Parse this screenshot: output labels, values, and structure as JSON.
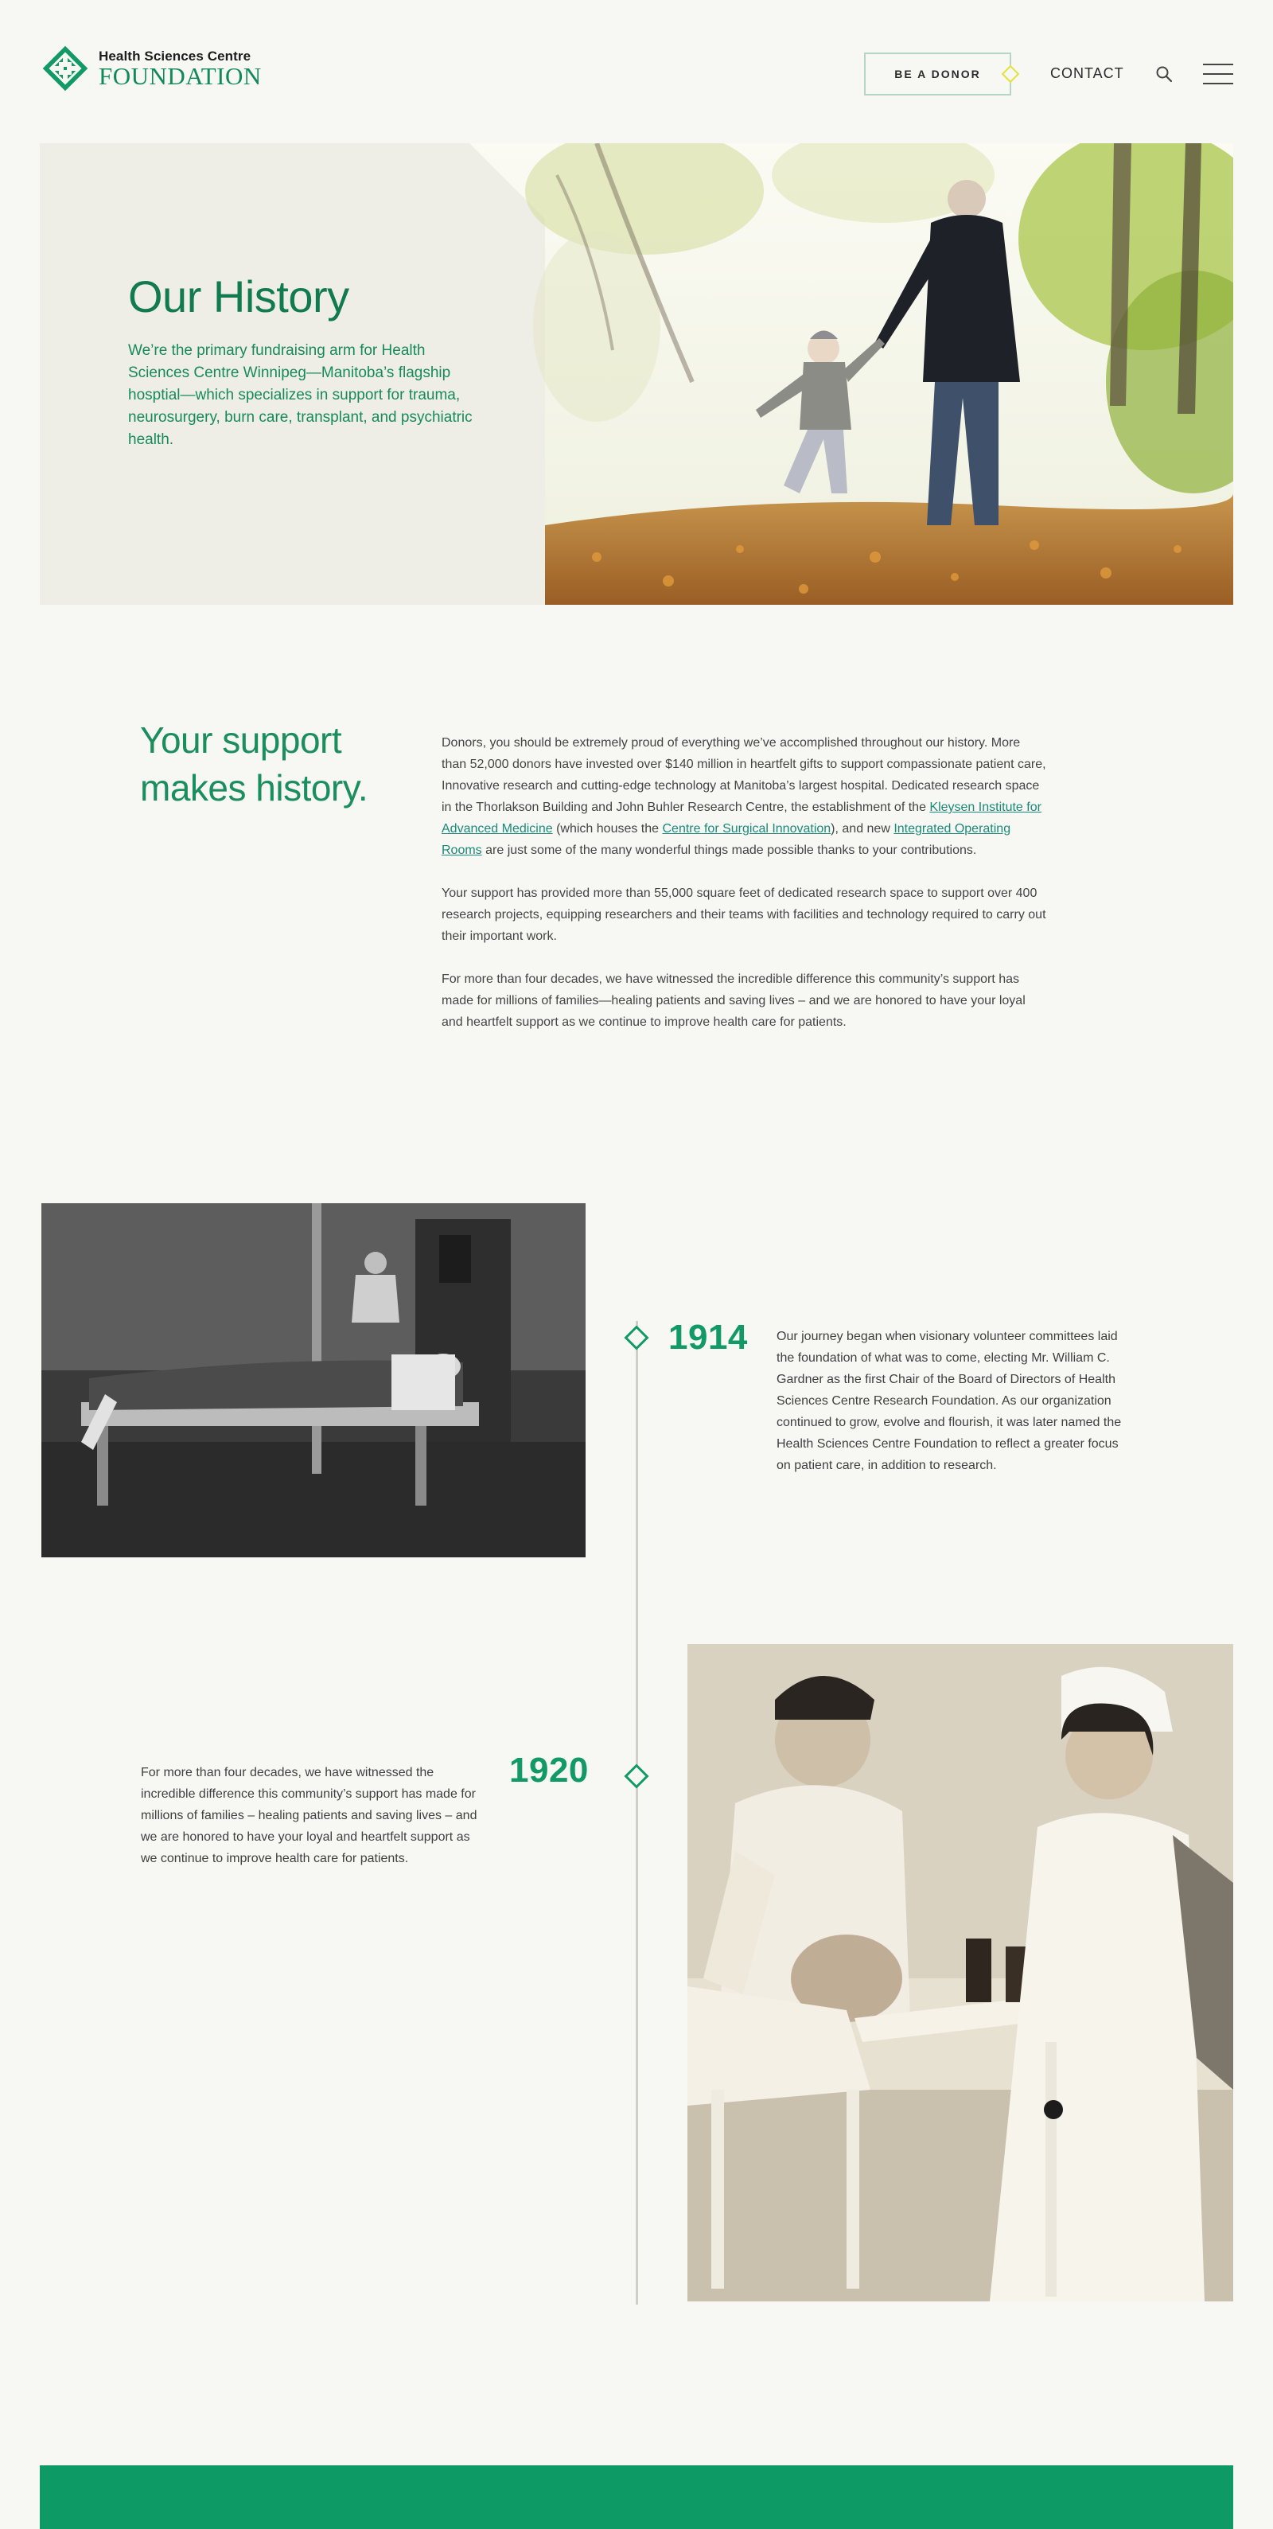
{
  "header": {
    "logo_top": "Health Sciences Centre",
    "logo_bottom": "FOUNDATION",
    "donor_button": "BE A DONOR",
    "contact_link": "CONTACT",
    "search_icon": "search-icon",
    "menu_icon": "hamburger-menu-icon"
  },
  "hero": {
    "title": "Our History",
    "subtitle": "We’re the primary fundraising arm for Health Sciences Centre Winnipeg—Manitoba’s flagship hosptial—which specializes in support for trauma, neurosurgery, burn care, transplant, and psychiatric health."
  },
  "support": {
    "heading_line1": "Your support",
    "heading_line2": "makes history.",
    "p1_part1": "Donors, you should be extremely proud of everything we’ve accomplished throughout our history. More than 52,000 donors have invested over $140 million in heartfelt gifts to support compassionate patient care, Innovative research and cutting-edge technology at Manitoba’s largest hospital. Dedicated research space in the Thorlakson Building and John Buhler Research Centre, the establishment of the ",
    "link_kleysen": "Kleysen Institute for Advanced Medicine",
    "p1_part2": " (which houses the ",
    "link_surgical": "Centre for Surgical Innovation",
    "p1_part3": "), and new ",
    "link_operating": "Integrated Operating Rooms",
    "p1_part4": " are just some of the many wonderful things made possible thanks to your contributions.",
    "p2": "Your support has provided more than 55,000 square feet of dedicated research space to support over 400 research projects, equipping researchers and their teams with facilities and technology required to carry out their important work.",
    "p3": "For more than four decades, we have witnessed the incredible difference this community’s support has made for millions of families—healing patients and saving lives – and we are honored to have your loyal and heartfelt support as we continue to improve health care for patients."
  },
  "timeline": [
    {
      "year": "1914",
      "text": "Our journey began when visionary volunteer committees laid the foundation of what was to come, electing Mr. William  C. Gardner as the first Chair of the Board of Directors of Health Sciences Centre Research Foundation. As our organization continued to grow, evolve and flourish, it was later named the Health Sciences Centre  Foundation to reflect a greater focus on patient care, in addition to research."
    },
    {
      "year": "1920",
      "text": "For more than four decades, we have witnessed the incredible difference this community’s support has made for millions  of families – healing patients and saving lives – and we are honored to  have your loyal and heartfelt support as we continue to improve health care for patients."
    }
  ],
  "colors": {
    "brand_green": "#119a65",
    "dark_green": "#117a4f",
    "accent_yellow": "#e4e23a",
    "background": "#f7f7f3",
    "hero_panel": "#eeede6"
  }
}
